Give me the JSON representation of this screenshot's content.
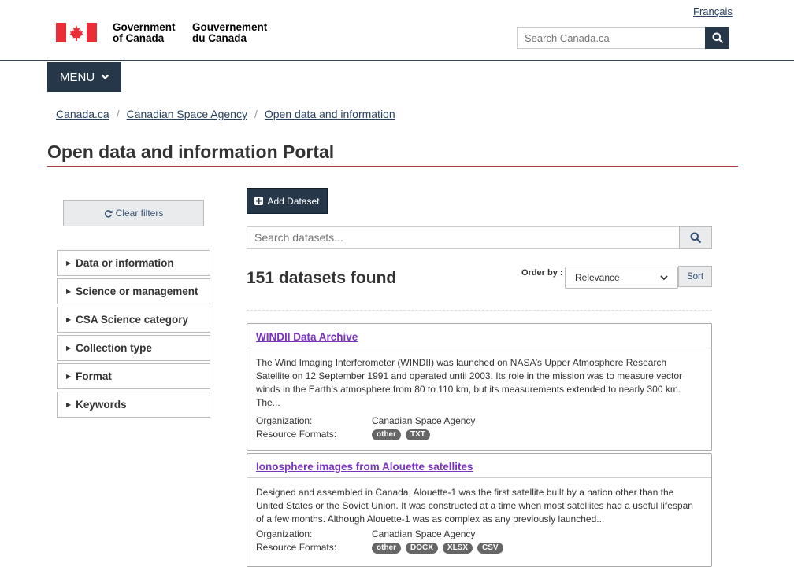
{
  "header": {
    "language_link": "Français",
    "signature_en_line1": "Government",
    "signature_en_line2": "of Canada",
    "signature_fr_line1": "Gouvernement",
    "signature_fr_line2": "du Canada",
    "search_placeholder": "Search Canada.ca",
    "menu_label": "MENU"
  },
  "breadcrumb": [
    "Canada.ca",
    "Canadian Space Agency",
    "Open data and information"
  ],
  "page": {
    "title": "Open data and information Portal"
  },
  "sidebar": {
    "clear_filters": "Clear filters",
    "facets": [
      "Data or information",
      "Science or management",
      "CSA Science category",
      "Collection type",
      "Format",
      "Keywords"
    ]
  },
  "main": {
    "add_dataset": "Add Dataset",
    "search_placeholder": "Search datasets...",
    "results_count": "151 datasets found",
    "order_by_label": "Order by :",
    "order_by_value": "Relevance",
    "sort_button": "Sort"
  },
  "datasets": [
    {
      "title": "WINDII Data Archive",
      "description": "The Wind Imaging Interferometer (WINDII) was launched on NASA’s Upper Atmosphere Research Satellite on 12 September 1991 and operated until 2003. Its role in the mission was to measure vector winds in the Earth’s atmosphere from 80 to 110 km, but its measurements extended to nearly 300 km. The...",
      "organization_label": "Organization:",
      "organization": "Canadian Space Agency",
      "formats_label": "Resource Formats:",
      "formats": [
        "other",
        "TXT"
      ]
    },
    {
      "title": "Ionosphere images from Alouette satellites",
      "description": "Designed and assembled in Canada, Alouette-1 was the first satellite built by a nation other than the United States or the Soviet Union. It was constructed at a time when most satellites had a useful lifespan of a few months. Although Alouette-1 was as complex as any previously launched...",
      "organization_label": "Organization:",
      "organization": "Canadian Space Agency",
      "formats_label": "Resource Formats:",
      "formats": [
        "other",
        "DOCX",
        "XLSX",
        "CSV"
      ]
    }
  ],
  "colors": {
    "gc_dark_blue": "#26374a",
    "flag_red": "#eb2d37",
    "title_rule": "#af3c43",
    "visited_link": "#7834bc"
  },
  "icons": {
    "search": "magnifier",
    "menu": "chevron-down",
    "clear": "refresh",
    "add": "plus-square",
    "facet": "triangle-right"
  }
}
